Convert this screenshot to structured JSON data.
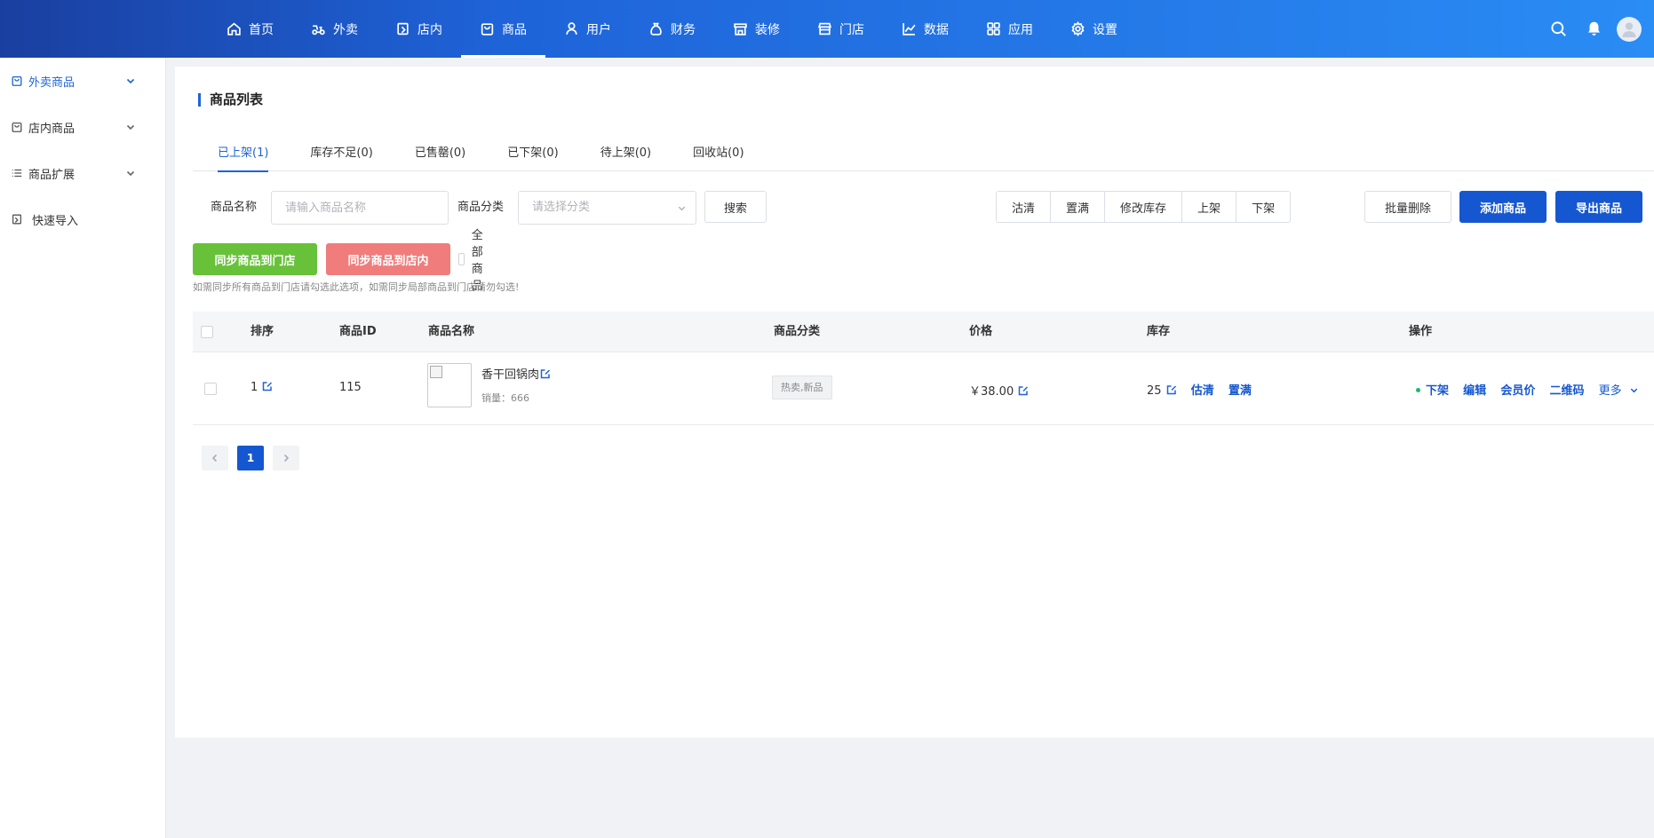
{
  "nav": {
    "items": [
      {
        "label": "首页",
        "icon": "home-icon"
      },
      {
        "label": "外卖",
        "icon": "scooter-icon"
      },
      {
        "label": "店内",
        "icon": "shop-icon"
      },
      {
        "label": "商品",
        "icon": "bag-icon",
        "active": true
      },
      {
        "label": "用户",
        "icon": "user-icon"
      },
      {
        "label": "财务",
        "icon": "money-bag-icon"
      },
      {
        "label": "装修",
        "icon": "store-front-icon"
      },
      {
        "label": "门店",
        "icon": "storefront-icon"
      },
      {
        "label": "数据",
        "icon": "chart-line-icon"
      },
      {
        "label": "应用",
        "icon": "grid-icon"
      },
      {
        "label": "设置",
        "icon": "gear-icon"
      }
    ]
  },
  "sidebar": {
    "items": [
      {
        "label": "外卖商品",
        "icon": "bag-icon",
        "active": true,
        "has_children": true
      },
      {
        "label": "店内商品",
        "icon": "shop-icon",
        "has_children": true
      },
      {
        "label": "商品扩展",
        "icon": "list-icon",
        "has_children": true
      },
      {
        "label": "快速导入",
        "icon": "import-icon",
        "has_children": false
      }
    ]
  },
  "page": {
    "title": "商品列表",
    "tabs": [
      "已上架(1)",
      "库存不足(0)",
      "已售罄(0)",
      "已下架(0)",
      "待上架(0)",
      "回收站(0)"
    ],
    "active_tab": 0
  },
  "filters": {
    "name_label": "商品名称",
    "name_placeholder": "请输入商品名称",
    "category_label": "商品分类",
    "category_placeholder": "请选择分类",
    "search_button": "搜索",
    "group_buttons": [
      "沽清",
      "置满",
      "修改库存",
      "上架",
      "下架"
    ],
    "batch_delete": "批量删除",
    "add_goods": "添加商品",
    "export_goods": "导出商品"
  },
  "sync": {
    "to_store": "同步商品到门店",
    "to_dine_in": "同步商品到店内",
    "all_goods": "全部商品",
    "hint": "如需同步所有商品到门店请勾选此选项，如需同步局部商品到门店请勿勾选!"
  },
  "table": {
    "headers": [
      "排序",
      "商品ID",
      "商品名称",
      "商品分类",
      "价格",
      "库存",
      "操作"
    ],
    "rows": [
      {
        "sort": "1",
        "id": "115",
        "name": "香干回锅肉",
        "sales": "销量：666",
        "category": "热卖,新品",
        "price": "￥38.00",
        "stock": "25",
        "stock_actions": [
          "估清",
          "置满"
        ],
        "actions": [
          "下架",
          "编辑",
          "会员价",
          "二维码",
          "更多"
        ]
      }
    ]
  },
  "pager": {
    "current": "1"
  },
  "colors": {
    "primary": "#1557d0",
    "green": "#67c23a",
    "red": "#f07c7c",
    "status_dot": "#19be6b"
  }
}
